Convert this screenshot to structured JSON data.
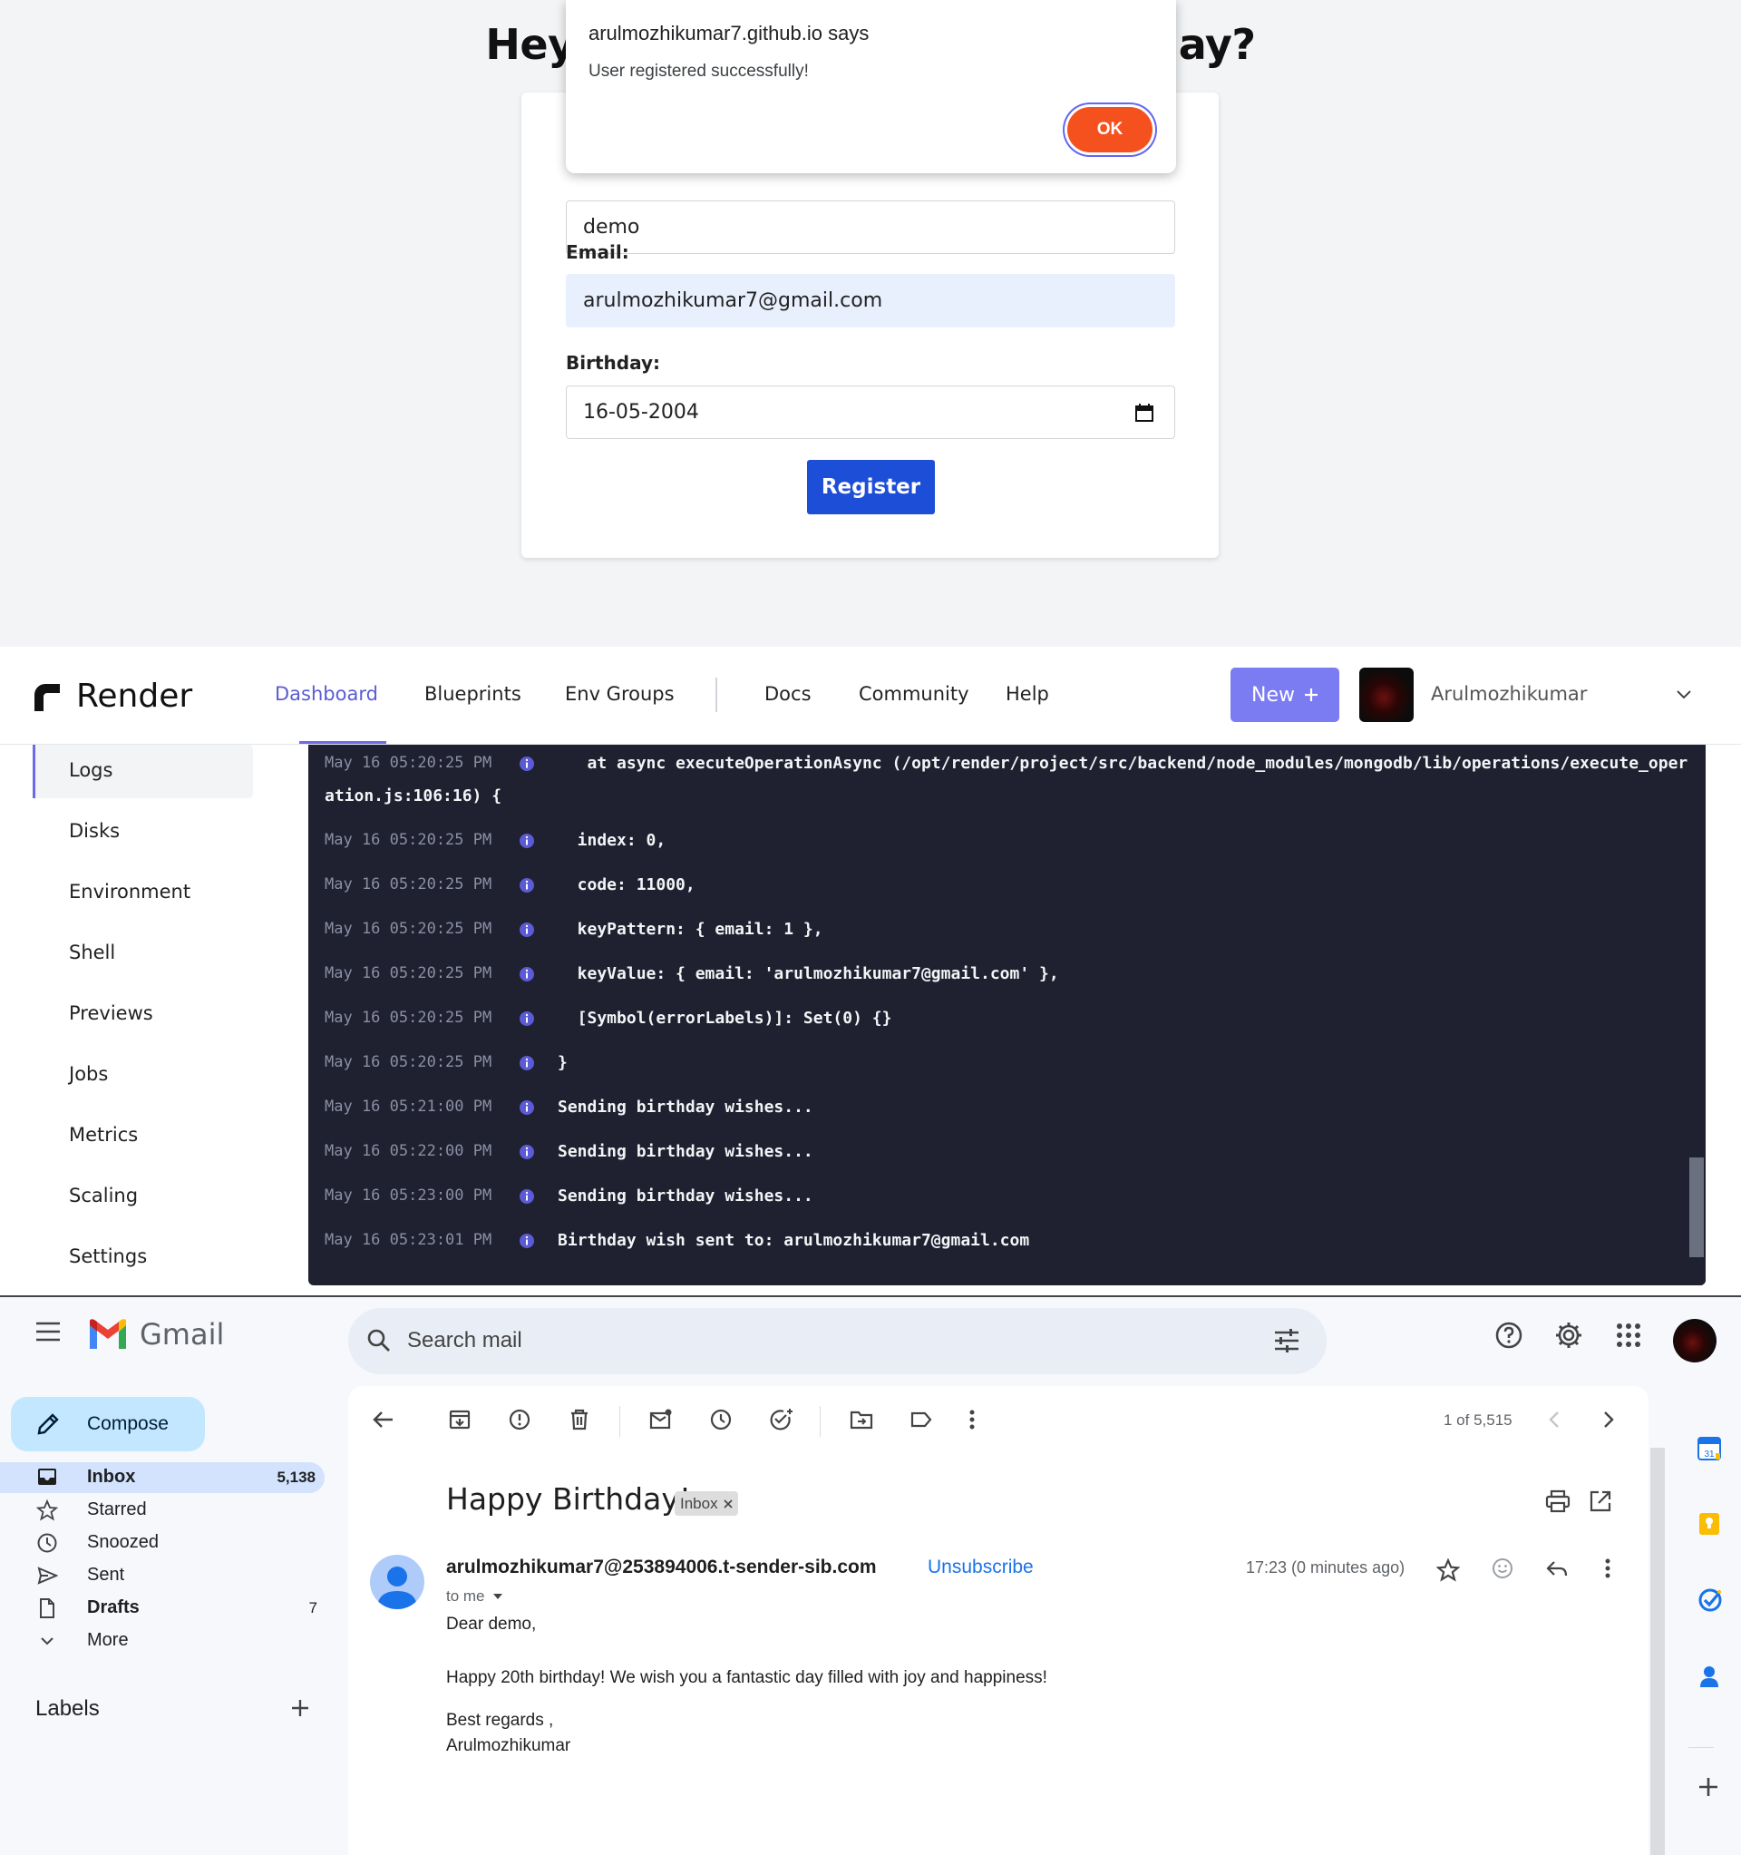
{
  "registration": {
    "title": "Hey, Can we know your birthday?",
    "name_value": "demo",
    "email_label": "Email:",
    "email_value": "arulmozhikumar7@gmail.com",
    "birthday_label": "Birthday:",
    "birthday_value": "16-05-2004",
    "register_label": "Register"
  },
  "alert": {
    "origin": "arulmozhikumar7.github.io says",
    "message": "User registered successfully!",
    "ok_label": "OK"
  },
  "render": {
    "brand": "Render",
    "nav": {
      "dashboard": "Dashboard",
      "blueprints": "Blueprints",
      "env_groups": "Env Groups",
      "docs": "Docs",
      "community": "Community",
      "help": "Help"
    },
    "new_label": "New",
    "user": "Arulmozhikumar",
    "sidebar": [
      "Logs",
      "Disks",
      "Environment",
      "Shell",
      "Previews",
      "Jobs",
      "Metrics",
      "Scaling",
      "Settings"
    ],
    "logs": [
      {
        "ts": "May 16 05:20:25 PM",
        "msg": "   at async executeOperationAsync (/opt/render/project/src/backend/node_modules/mongodb/lib/operations/execute_oper"
      },
      {
        "ts": "",
        "msg": "ation.js:106:16) {"
      },
      {
        "ts": "May 16 05:20:25 PM",
        "msg": "  index: 0,"
      },
      {
        "ts": "May 16 05:20:25 PM",
        "msg": "  code: 11000,"
      },
      {
        "ts": "May 16 05:20:25 PM",
        "msg": "  keyPattern: { email: 1 },"
      },
      {
        "ts": "May 16 05:20:25 PM",
        "msg": "  keyValue: { email: 'arulmozhikumar7@gmail.com' },"
      },
      {
        "ts": "May 16 05:20:25 PM",
        "msg": "  [Symbol(errorLabels)]: Set(0) {}"
      },
      {
        "ts": "May 16 05:20:25 PM",
        "msg": "}"
      },
      {
        "ts": "May 16 05:21:00 PM",
        "msg": "Sending birthday wishes..."
      },
      {
        "ts": "May 16 05:22:00 PM",
        "msg": "Sending birthday wishes..."
      },
      {
        "ts": "May 16 05:23:00 PM",
        "msg": "Sending birthday wishes..."
      },
      {
        "ts": "May 16 05:23:01 PM",
        "msg": "Birthday wish sent to: arulmozhikumar7@gmail.com"
      }
    ]
  },
  "gmail": {
    "brand": "Gmail",
    "search_placeholder": "Search mail",
    "compose_label": "Compose",
    "nav": [
      {
        "label": "Inbox",
        "count": "5,138",
        "icon": "inbox-icon"
      },
      {
        "label": "Starred",
        "count": "",
        "icon": "star-icon"
      },
      {
        "label": "Snoozed",
        "count": "",
        "icon": "clock-icon"
      },
      {
        "label": "Sent",
        "count": "",
        "icon": "send-icon"
      },
      {
        "label": "Drafts",
        "count": "7",
        "icon": "draft-icon"
      },
      {
        "label": "More",
        "count": "",
        "icon": "chevron-down-icon"
      }
    ],
    "labels_heading": "Labels",
    "pager": "1 of 5,515",
    "subject": "Happy Birthday!",
    "tag": "Inbox",
    "sender": "arulmozhikumar7@253894006.t-sender-sib.com",
    "unsubscribe": "Unsubscribe",
    "to": "to me",
    "time": "17:23 (0 minutes ago)",
    "body": {
      "greeting": "Dear demo,",
      "line1": "Happy 20th birthday! We wish you a fantastic day filled with joy and happiness!",
      "signoff": "Best regards ,",
      "signature": "Arulmozhikumar"
    },
    "colors": {
      "accent": "#1a73e8",
      "compose": "#c2e7ff",
      "inbox_active": "#d3e3fd"
    }
  }
}
